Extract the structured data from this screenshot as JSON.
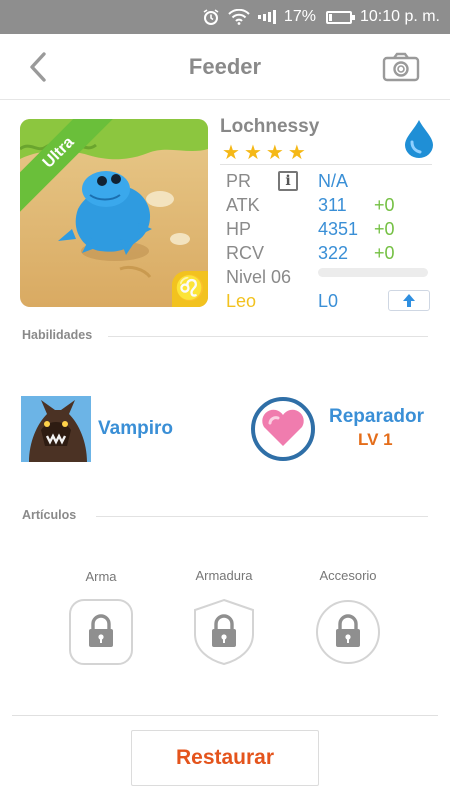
{
  "status_bar": {
    "battery_percent": "17%",
    "battery_level": 0.17,
    "time": "10:10 p. m."
  },
  "header": {
    "title": "Feeder",
    "back_icon": "chevron-left-icon",
    "camera_icon": "camera-icon"
  },
  "monster": {
    "name": "Lochnessy",
    "tier": "Ultra",
    "stars": 4,
    "element_icon": "water-drop-icon",
    "zodiac_glyph": "♌",
    "stats": {
      "pr": {
        "label": "PR",
        "value": "N/A"
      },
      "atk": {
        "label": "ATK",
        "value": "311",
        "bonus": "+0"
      },
      "hp": {
        "label": "HP",
        "value": "4351",
        "bonus": "+0"
      },
      "rcv": {
        "label": "RCV",
        "value": "322",
        "bonus": "+0"
      }
    },
    "level_label": "Nivel 06",
    "level_progress": 0.0,
    "zodiac_label": "Leo",
    "evolution_level": "L0"
  },
  "sections": {
    "skills": "Habilidades",
    "items": "Artículos"
  },
  "skills": [
    {
      "name": "Vampiro",
      "icon": "werewolf-portrait"
    },
    {
      "name": "Reparador",
      "level": "LV 1",
      "icon": "heart-icon"
    }
  ],
  "equipment": [
    {
      "label": "Arma",
      "icon": "lock-icon"
    },
    {
      "label": "Armadura",
      "icon": "lock-icon"
    },
    {
      "label": "Accesorio",
      "icon": "lock-icon"
    }
  ],
  "restore_button": "Restaurar",
  "colors": {
    "accent_blue": "#3a8fd6",
    "bonus_green": "#74c043",
    "star_gold": "#f5b816",
    "zodiac_gold": "#f2c21f",
    "level_orange": "#e46d1a",
    "restore_red": "#e4541c",
    "tier_green": "#6abf3a"
  }
}
